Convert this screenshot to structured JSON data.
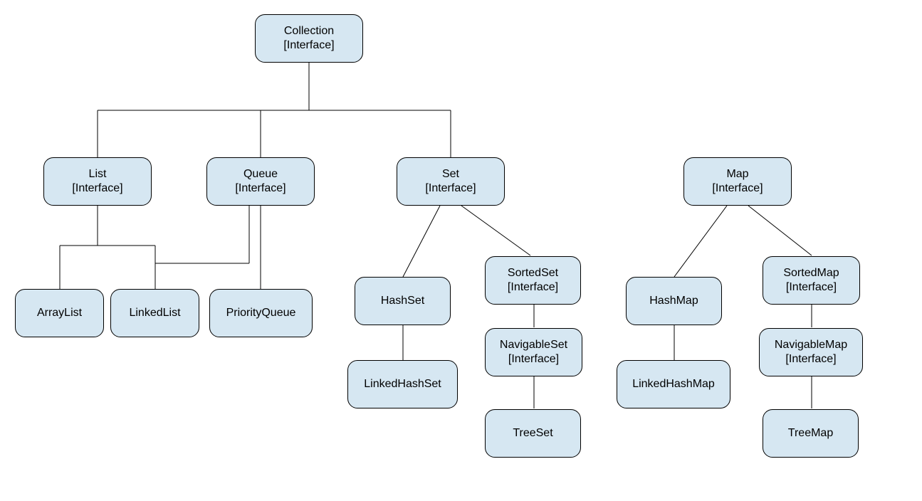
{
  "nodes": {
    "collection": {
      "line1": "Collection",
      "line2": "[Interface]"
    },
    "list": {
      "line1": "List",
      "line2": "[Interface]"
    },
    "queue": {
      "line1": "Queue",
      "line2": "[Interface]"
    },
    "set": {
      "line1": "Set",
      "line2": "[Interface]"
    },
    "map": {
      "line1": "Map",
      "line2": "[Interface]"
    },
    "arraylist": {
      "line1": "ArrayList"
    },
    "linkedlist": {
      "line1": "LinkedList"
    },
    "priorityqueue": {
      "line1": "PriorityQueue"
    },
    "hashset": {
      "line1": "HashSet"
    },
    "linkedhashset": {
      "line1": "LinkedHashSet"
    },
    "sortedset": {
      "line1": "SortedSet",
      "line2": "[Interface]"
    },
    "navigableset": {
      "line1": "NavigableSet",
      "line2": "[Interface]"
    },
    "treeset": {
      "line1": "TreeSet"
    },
    "hashmap": {
      "line1": "HashMap"
    },
    "linkedhashmap": {
      "line1": "LinkedHashMap"
    },
    "sortedmap": {
      "line1": "SortedMap",
      "line2": "[Interface]"
    },
    "navigablemap": {
      "line1": "NavigableMap",
      "line2": "[Interface]"
    },
    "treemap": {
      "line1": "TreeMap"
    }
  }
}
